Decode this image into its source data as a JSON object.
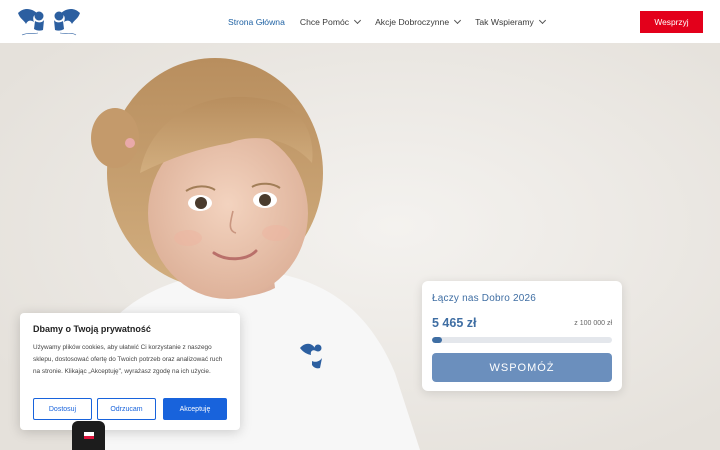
{
  "header": {
    "logo_icon": "angel-wings-logo-icon",
    "nav": [
      {
        "label": "Strona Główna",
        "active": true,
        "dropdown": false
      },
      {
        "label": "Chce Pomóc",
        "active": false,
        "dropdown": true
      },
      {
        "label": "Akcje Dobroczynne",
        "active": false,
        "dropdown": true
      },
      {
        "label": "Tak Wspieramy",
        "active": false,
        "dropdown": true
      }
    ],
    "donate_label": "Wesprzyj"
  },
  "donation": {
    "title": "Łączy nas Dobro 2026",
    "amount": "5 465 zł",
    "goal": "z 100 000 zł",
    "progress_fraction": 0.055,
    "button_label": "WSPOMÓŻ"
  },
  "cookie": {
    "title": "Dbamy o Twoją prywatność",
    "text": "Używamy plików cookies, aby ułatwić Ci korzystanie z naszego sklepu, dostosować ofertę do Twoich potrzeb oraz analizować ruch na stronie. Klikając „Akceptuję\", wyrażasz zgodę na ich użycie.",
    "buttons": {
      "customize": "Dostosuj",
      "reject": "Odrzucam",
      "accept": "Akceptuję"
    }
  },
  "language": {
    "current_flag_icon": "poland-flag-icon"
  },
  "colors": {
    "primary_blue": "#3f6ea3",
    "nav_active": "#1f62a4",
    "donate_red": "#e3001b",
    "cookie_blue": "#1863dc"
  }
}
